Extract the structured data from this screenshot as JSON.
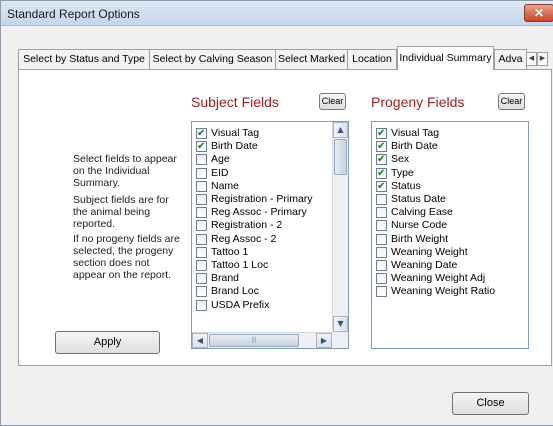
{
  "window": {
    "title": "Standard Report Options"
  },
  "tabs": [
    {
      "label": "Select by Status and Type",
      "active": false
    },
    {
      "label": "Select by Calving Season",
      "active": false
    },
    {
      "label": "Select Marked",
      "active": false
    },
    {
      "label": "Location",
      "active": false
    },
    {
      "label": "Individual Summary",
      "active": true
    },
    {
      "label": "Adva",
      "active": false
    }
  ],
  "help": {
    "p1": [
      "Select fields to appear",
      "on the Individual",
      "Summary."
    ],
    "p2": [
      "Subject fields are for",
      "the animal being",
      "reported."
    ],
    "p3": [
      "If no progeny fields are",
      "selected, the progeny",
      "section does not",
      "appear on the report."
    ]
  },
  "subject": {
    "heading": "Subject Fields",
    "clear_label": "Clear",
    "items": [
      {
        "label": "Visual Tag",
        "checked": true
      },
      {
        "label": "Birth Date",
        "checked": true
      },
      {
        "label": "Age",
        "checked": false
      },
      {
        "label": "EID",
        "checked": false
      },
      {
        "label": "Name",
        "checked": false
      },
      {
        "label": "Registration - Primary",
        "checked": false
      },
      {
        "label": "Reg Assoc - Primary",
        "checked": false
      },
      {
        "label": "Registration - 2",
        "checked": false
      },
      {
        "label": "Reg Assoc - 2",
        "checked": false
      },
      {
        "label": "Tattoo 1",
        "checked": false
      },
      {
        "label": "Tattoo 1 Loc",
        "checked": false
      },
      {
        "label": "Brand",
        "checked": false
      },
      {
        "label": "Brand Loc",
        "checked": false
      },
      {
        "label": "USDA Prefix",
        "checked": false
      }
    ]
  },
  "progeny": {
    "heading": "Progeny Fields",
    "clear_label": "Clear",
    "items": [
      {
        "label": "Visual Tag",
        "checked": true
      },
      {
        "label": "Birth Date",
        "checked": true
      },
      {
        "label": "Sex",
        "checked": true
      },
      {
        "label": "Type",
        "checked": true
      },
      {
        "label": "Status",
        "checked": true
      },
      {
        "label": "Status Date",
        "checked": false
      },
      {
        "label": "Calving Ease",
        "checked": false
      },
      {
        "label": "Nurse Code",
        "checked": false
      },
      {
        "label": "Birth Weight",
        "checked": false
      },
      {
        "label": "Weaning Weight",
        "checked": false
      },
      {
        "label": "Weaning Date",
        "checked": false
      },
      {
        "label": "Weaning Weight Adj",
        "checked": false
      },
      {
        "label": "Weaning Weight Ratio",
        "checked": false
      }
    ]
  },
  "buttons": {
    "apply": "Apply",
    "close": "Close"
  }
}
